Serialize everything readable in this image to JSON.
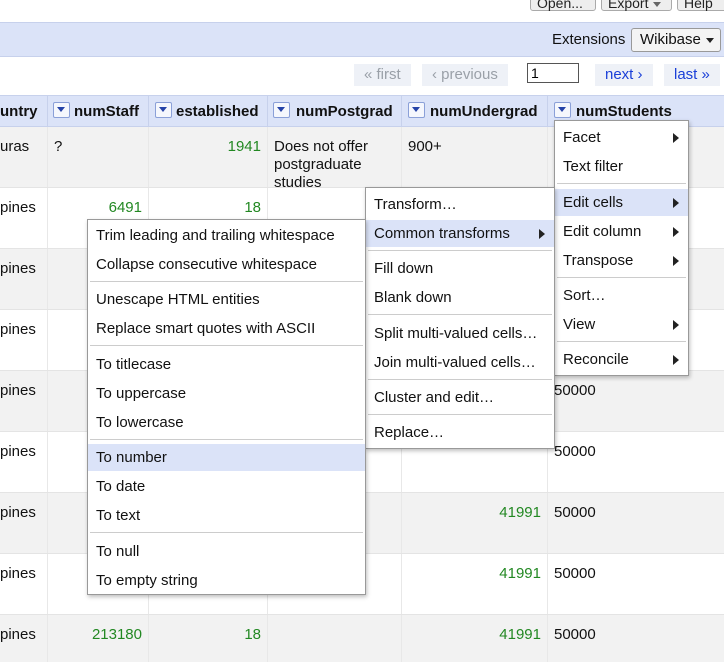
{
  "toolbar": {
    "open_label": "Open...",
    "export_label": "Export",
    "help_label": "Help"
  },
  "extensions": {
    "label": "Extensions",
    "wikibase_label": "Wikibase"
  },
  "pager": {
    "first": "« first",
    "previous": "‹ previous",
    "page_value": "1",
    "next": "next ›",
    "last": "last »"
  },
  "columns": [
    "untry",
    "numStaff",
    "established",
    "numPostgrad",
    "numUndergrad",
    "numStudents"
  ],
  "rows": [
    {
      "country": "uras",
      "numStaff": "?",
      "established": "1941",
      "postgrad_l1": "Does not offer",
      "postgrad_l2": "postgraduate",
      "postgrad_l3": "studies",
      "numUndergrad": "900+",
      "numStudents": ""
    },
    {
      "country": "pines",
      "numStaff": "6491",
      "established": "18",
      "numUndergrad": "",
      "numStudents": ""
    },
    {
      "country": "pines",
      "numStaff": "",
      "established": "",
      "numUndergrad": "",
      "numStudents": ""
    },
    {
      "country": "pines",
      "numStaff": "",
      "established": "",
      "numUndergrad": "",
      "numStudents": ""
    },
    {
      "country": "pines",
      "numStaff": "",
      "established": "",
      "numUndergrad": "",
      "numStudents": "50000"
    },
    {
      "country": "pines",
      "numStaff": "",
      "established": "",
      "numUndergrad": "",
      "numStudents": "50000"
    },
    {
      "country": "pines",
      "numStaff": "",
      "established": "",
      "numUndergrad": "41991",
      "numStudents": "50000"
    },
    {
      "country": "pines",
      "numStaff": "",
      "established": "",
      "numUndergrad": "41991",
      "numStudents": "50000"
    },
    {
      "country": "pines",
      "numStaff": "213180",
      "established": "18",
      "numUndergrad": "41991",
      "numStudents": "50000"
    }
  ],
  "column_menu": {
    "facet": "Facet",
    "text_filter": "Text filter",
    "edit_cells": "Edit cells",
    "edit_column": "Edit column",
    "transpose": "Transpose",
    "sort": "Sort…",
    "view": "View",
    "reconcile": "Reconcile"
  },
  "edit_cells_menu": {
    "transform": "Transform…",
    "common_transforms": "Common transforms",
    "fill_down": "Fill down",
    "blank_down": "Blank down",
    "split": "Split multi-valued cells…",
    "join": "Join multi-valued cells…",
    "cluster": "Cluster and edit…",
    "replace": "Replace…"
  },
  "common_transforms_menu": {
    "trim": "Trim leading and trailing whitespace",
    "collapse": "Collapse consecutive whitespace",
    "unescape": "Unescape HTML entities",
    "smart_quotes": "Replace smart quotes with ASCII",
    "titlecase": "To titlecase",
    "uppercase": "To uppercase",
    "lowercase": "To lowercase",
    "to_number": "To number",
    "to_date": "To date",
    "to_text": "To text",
    "to_null": "To null",
    "to_empty": "To empty string"
  }
}
